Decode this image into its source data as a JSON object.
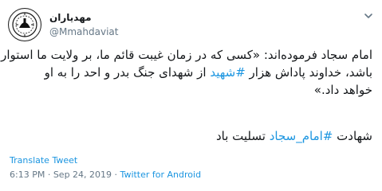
{
  "user": {
    "display_name": "مهدیاران",
    "handle": "@Mmahdaviat"
  },
  "tweet": {
    "line1": "امام سجاد فرموده‌اند: «کسی که در زمان غیبت قائم ما، بر ولایت ما استوار",
    "line2_before": "باشد، خداوند پاداش هزار ",
    "line2_hashtag": "#شهید",
    "line2_after": " از شهدای جنگ بدر و احد را به او",
    "line3": "خواهد داد.»",
    "para2_before": "شهادت ",
    "para2_hashtag": "#امام_سجاد",
    "para2_after": " تسلیت باد"
  },
  "translate_label": "Translate Tweet",
  "meta": {
    "time": "6:13 PM",
    "separator1": " · ",
    "date": "Sep 24, 2019",
    "separator2": " · ",
    "source": "Twitter for Android"
  },
  "colors": {
    "link": "#1b95e0",
    "text": "#14171a",
    "muted": "#657786"
  },
  "icons": {
    "avatar": "mahdaviat-logo-icon",
    "caret": "chevron-down-icon"
  }
}
